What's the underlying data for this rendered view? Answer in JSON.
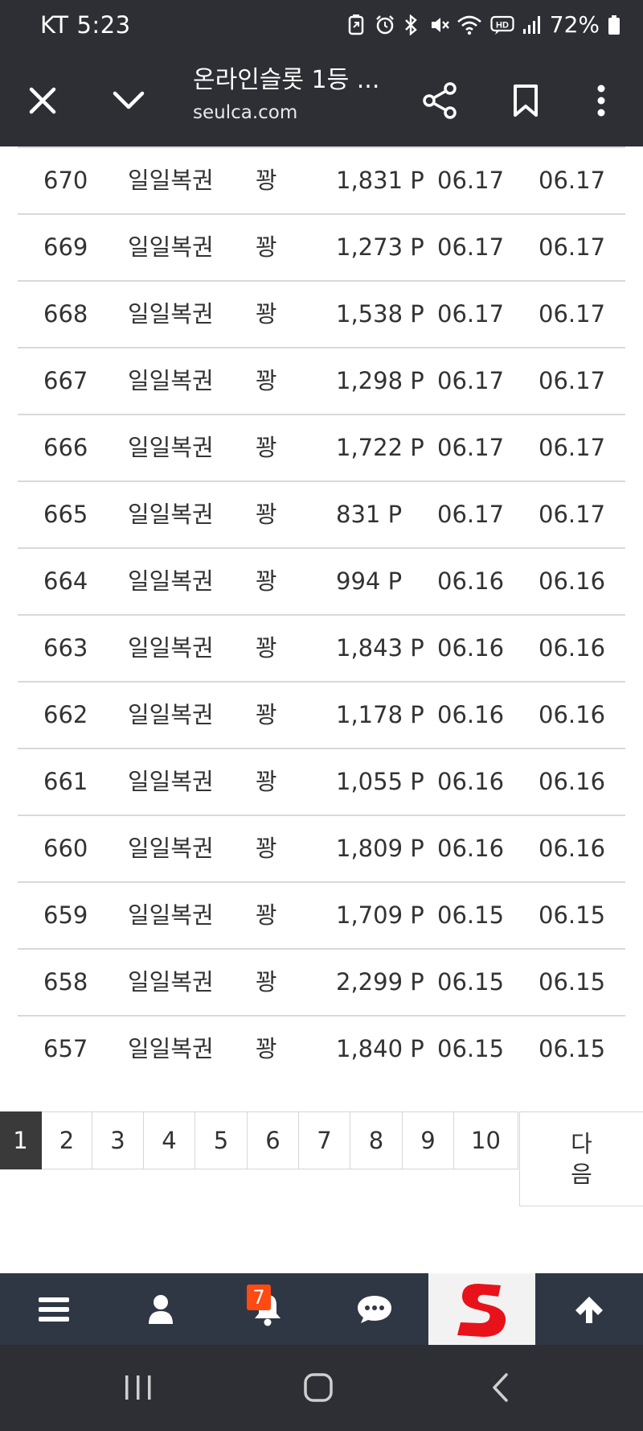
{
  "status_bar": {
    "carrier": "KT",
    "time": "5:23",
    "battery": "72%"
  },
  "toolbar": {
    "title": "온라인슬롯 1등 ...",
    "url": "seulca.com"
  },
  "rows": [
    {
      "no": "670",
      "name": "일일복권",
      "result": "꽝",
      "point": "1,831 P",
      "date1": "06.17",
      "date2": "06.17"
    },
    {
      "no": "669",
      "name": "일일복권",
      "result": "꽝",
      "point": "1,273 P",
      "date1": "06.17",
      "date2": "06.17"
    },
    {
      "no": "668",
      "name": "일일복권",
      "result": "꽝",
      "point": "1,538 P",
      "date1": "06.17",
      "date2": "06.17"
    },
    {
      "no": "667",
      "name": "일일복권",
      "result": "꽝",
      "point": "1,298 P",
      "date1": "06.17",
      "date2": "06.17"
    },
    {
      "no": "666",
      "name": "일일복권",
      "result": "꽝",
      "point": "1,722 P",
      "date1": "06.17",
      "date2": "06.17"
    },
    {
      "no": "665",
      "name": "일일복권",
      "result": "꽝",
      "point": "831 P",
      "date1": "06.17",
      "date2": "06.17"
    },
    {
      "no": "664",
      "name": "일일복권",
      "result": "꽝",
      "point": "994 P",
      "date1": "06.16",
      "date2": "06.16"
    },
    {
      "no": "663",
      "name": "일일복권",
      "result": "꽝",
      "point": "1,843 P",
      "date1": "06.16",
      "date2": "06.16"
    },
    {
      "no": "662",
      "name": "일일복권",
      "result": "꽝",
      "point": "1,178 P",
      "date1": "06.16",
      "date2": "06.16"
    },
    {
      "no": "661",
      "name": "일일복권",
      "result": "꽝",
      "point": "1,055 P",
      "date1": "06.16",
      "date2": "06.16"
    },
    {
      "no": "660",
      "name": "일일복권",
      "result": "꽝",
      "point": "1,809 P",
      "date1": "06.16",
      "date2": "06.16"
    },
    {
      "no": "659",
      "name": "일일복권",
      "result": "꽝",
      "point": "1,709 P",
      "date1": "06.15",
      "date2": "06.15"
    },
    {
      "no": "658",
      "name": "일일복권",
      "result": "꽝",
      "point": "2,299 P",
      "date1": "06.15",
      "date2": "06.15"
    },
    {
      "no": "657",
      "name": "일일복권",
      "result": "꽝",
      "point": "1,840 P",
      "date1": "06.15",
      "date2": "06.15"
    }
  ],
  "pagination": {
    "pages": [
      "1",
      "2",
      "3",
      "4",
      "5",
      "6",
      "7",
      "8",
      "9",
      "10"
    ],
    "active": "1",
    "next_line1": "다",
    "next_line2": "음"
  },
  "bottom_nav": {
    "notification_count": "7"
  },
  "colors": {
    "chrome_bg": "#2d2f34",
    "bottom_nav_bg": "#2f3744",
    "badge": "#ff4a12",
    "logo_red": "#e8121b"
  }
}
